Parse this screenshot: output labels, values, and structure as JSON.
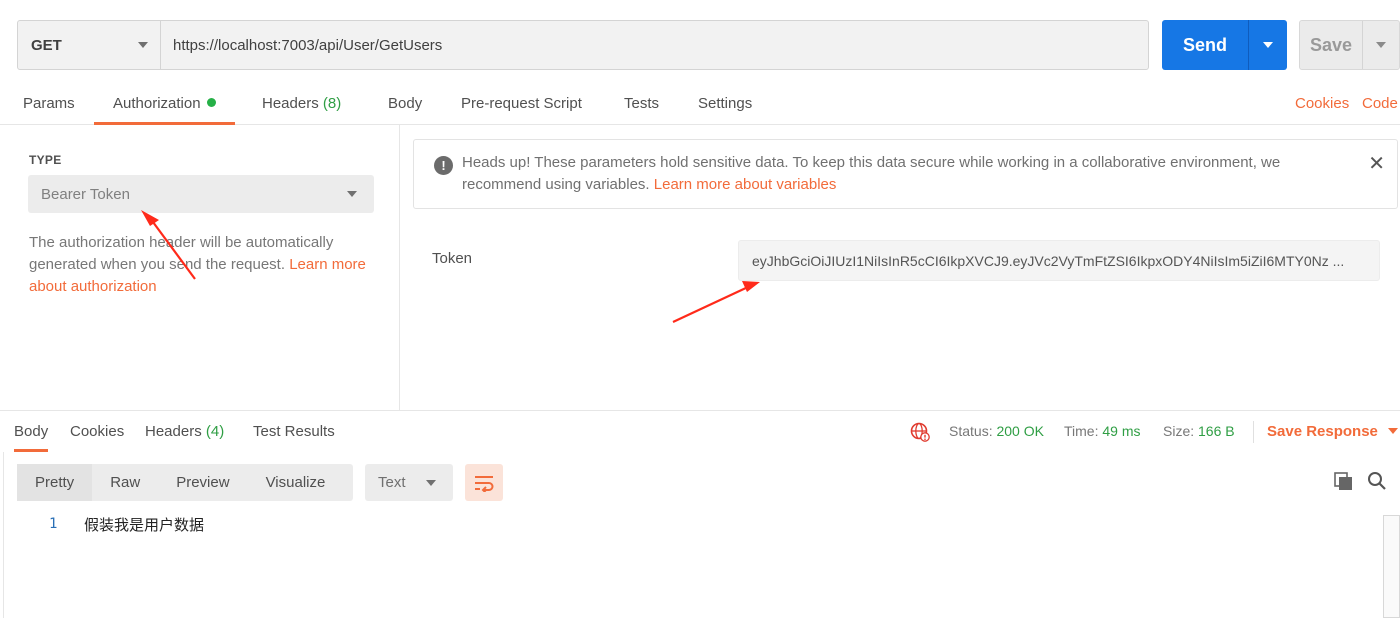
{
  "request": {
    "method": "GET",
    "url": "https://localhost:7003/api/User/GetUsers",
    "send_label": "Send",
    "save_label": "Save"
  },
  "request_tabs": {
    "params": "Params",
    "authorization": "Authorization",
    "headers": "Headers",
    "headers_count": "(8)",
    "body": "Body",
    "prerequest": "Pre-request Script",
    "tests": "Tests",
    "settings": "Settings",
    "cookies": "Cookies",
    "code": "Code"
  },
  "auth": {
    "type_label": "TYPE",
    "type_value": "Bearer Token",
    "description": "The authorization header will be automatically generated when you send the request. ",
    "learn_more": "Learn more about authorization"
  },
  "notice": {
    "text": "Heads up! These parameters hold sensitive data. To keep this data secure while working in a collaborative environment, we recommend using variables. ",
    "link": "Learn more about variables",
    "icon": "!"
  },
  "token": {
    "label": "Token",
    "value": "eyJhbGciOiJIUzI1NiIsInR5cCI6IkpXVCJ9.eyJVc2VyTmFtZSI6IkpxODY4NiIsIm5iZiI6MTY0Nz ..."
  },
  "response_tabs": {
    "body": "Body",
    "cookies": "Cookies",
    "headers": "Headers",
    "headers_count": "(4)",
    "test_results": "Test Results"
  },
  "response_status": {
    "status_label": "Status:",
    "status_value": "200 OK",
    "time_label": "Time:",
    "time_value": "49 ms",
    "size_label": "Size:",
    "size_value": "166 B",
    "save_response": "Save Response"
  },
  "body_view": {
    "pretty": "Pretty",
    "raw": "Raw",
    "preview": "Preview",
    "visualize": "Visualize",
    "format": "Text"
  },
  "response_body": {
    "line_number": "1",
    "content": "假装我是用户数据"
  },
  "colors": {
    "accent": "#f26b3a",
    "primary": "#1677e5",
    "success": "#2f9e44",
    "annotation": "#ff2a1a"
  }
}
